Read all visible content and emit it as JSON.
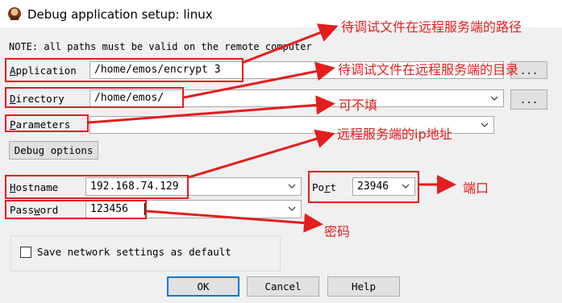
{
  "window": {
    "title": "Debug application setup: linux",
    "icon": "ida-debugger-icon"
  },
  "note": "NOTE: all paths must be valid on the remote computer",
  "application": {
    "label_key": "A",
    "label_rest": "pplication",
    "value": "/home/emos/encrypt 3",
    "browse_label": "..."
  },
  "directory": {
    "label_key": "D",
    "label_rest": "irectory",
    "value": "/home/emos/",
    "browse_label": "..."
  },
  "parameters": {
    "label_key": "P",
    "label_rest": "arameters",
    "value": ""
  },
  "debug_options_label": "Debug options",
  "hostname": {
    "label_key": "H",
    "label_rest": "ostname",
    "value": "192.168.74.129"
  },
  "port": {
    "label_pre": "Po",
    "label_key": "r",
    "label_post": "t",
    "value": "23946"
  },
  "password": {
    "label_pre": "Pass",
    "label_key": "w",
    "label_post": "ord",
    "value": "123456"
  },
  "save_network_label": "Save network settings as default",
  "buttons": {
    "ok": "OK",
    "cancel": "Cancel",
    "help": "Help"
  },
  "annotations": {
    "application": "待调试文件在远程服务端的路径",
    "directory": "待调试文件在远程服务端的目录",
    "parameters": "可不填",
    "hostname": "远程服务端的ip地址",
    "port": "端口",
    "password": "密码",
    "color": "#e31e1e"
  }
}
